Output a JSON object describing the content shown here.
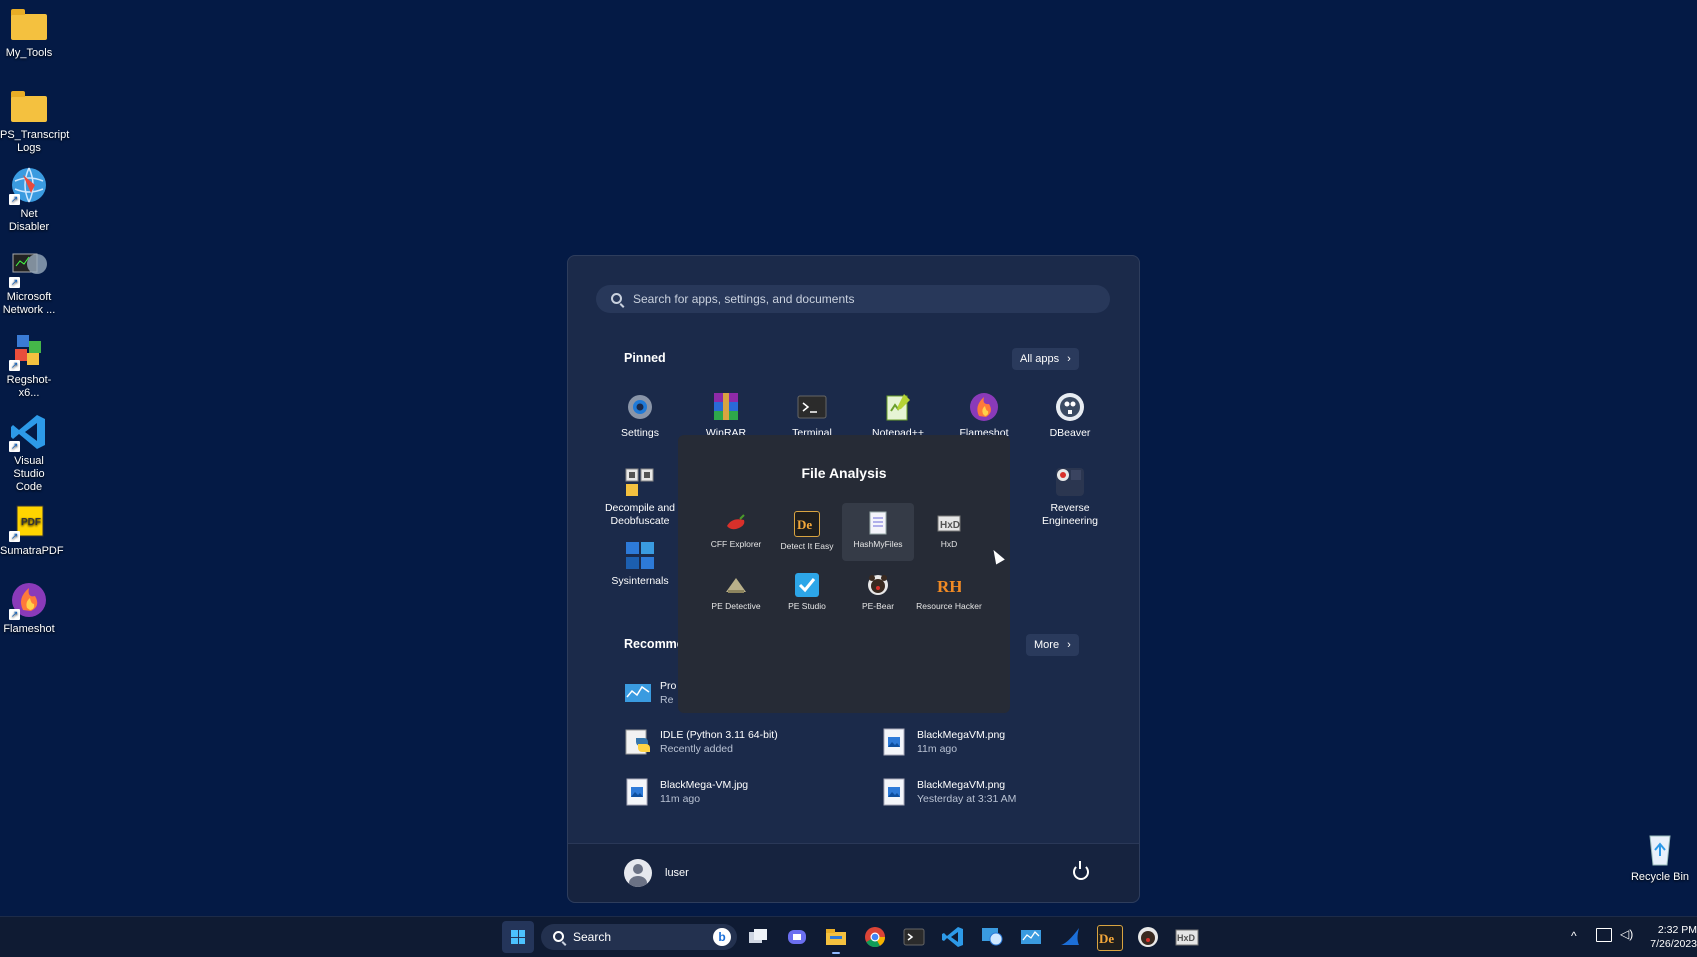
{
  "desktop": {
    "icons": [
      {
        "label": "My_Tools",
        "icon": "folder-icon"
      },
      {
        "label": "PS_Transcript Logs",
        "icon": "folder-icon"
      },
      {
        "label": "Net Disabler",
        "icon": "globe-icon"
      },
      {
        "label": "Microsoft Network ...",
        "icon": "network-monitor-icon"
      },
      {
        "label": "Regshot-x6...",
        "icon": "regshot-icon"
      },
      {
        "label": "Visual Studio Code",
        "icon": "vscode-icon"
      },
      {
        "label": "SumatraPDF",
        "icon": "pdf-icon"
      },
      {
        "label": "Flameshot",
        "icon": "flameshot-icon"
      }
    ],
    "recycle_bin": "Recycle Bin"
  },
  "start_menu": {
    "search_placeholder": "Search for apps, settings, and documents",
    "pinned_title": "Pinned",
    "all_apps": "All apps",
    "pinned": [
      {
        "label": "Settings",
        "icon": "settings-icon"
      },
      {
        "label": "WinRAR",
        "icon": "winrar-icon"
      },
      {
        "label": "Terminal",
        "icon": "terminal-icon"
      },
      {
        "label": "Notepad++",
        "icon": "notepadpp-icon"
      },
      {
        "label": "Flameshot",
        "icon": "flameshot-icon"
      },
      {
        "label": "DBeaver",
        "icon": "dbeaver-icon"
      },
      {
        "label": "Decompile and Deobfuscate",
        "icon": "folder-group-icon"
      },
      {
        "label": "Reverse Engineering",
        "icon": "folder-group-icon"
      },
      {
        "label": "Sysinternals",
        "icon": "folder-group-icon"
      }
    ],
    "recommended_title": "Recomme",
    "more": "More",
    "recommended": [
      {
        "title": "Pro",
        "sub": "Re",
        "icon": "perfmon-icon"
      },
      {
        "title": "IDLE (Python 3.11 64-bit)",
        "sub": "Recently added",
        "icon": "python-idle-icon"
      },
      {
        "title": "BlackMegaVM.png",
        "sub": "11m ago",
        "icon": "image-file-icon"
      },
      {
        "title": "BlackMega-VM.jpg",
        "sub": "11m ago",
        "icon": "image-file-icon"
      },
      {
        "title": "BlackMegaVM.png",
        "sub": "Yesterday at 3:31 AM",
        "icon": "image-file-icon"
      }
    ],
    "user": "luser"
  },
  "folder_popup": {
    "title": "File Analysis",
    "apps": [
      {
        "label": "CFF Explorer",
        "icon": "cff-explorer-icon"
      },
      {
        "label": "Detect It Easy",
        "icon": "detect-it-easy-icon"
      },
      {
        "label": "HashMyFiles",
        "icon": "hashmyfiles-icon"
      },
      {
        "label": "HxD",
        "icon": "hxd-icon"
      },
      {
        "label": "PE Detective",
        "icon": "pe-detective-icon"
      },
      {
        "label": "PE Studio",
        "icon": "pe-studio-icon"
      },
      {
        "label": "PE-Bear",
        "icon": "pe-bear-icon"
      },
      {
        "label": "Resource Hacker",
        "icon": "resource-hacker-icon"
      }
    ]
  },
  "taskbar": {
    "search_label": "Search",
    "time": "2:32 PM",
    "date": "7/26/2023"
  }
}
